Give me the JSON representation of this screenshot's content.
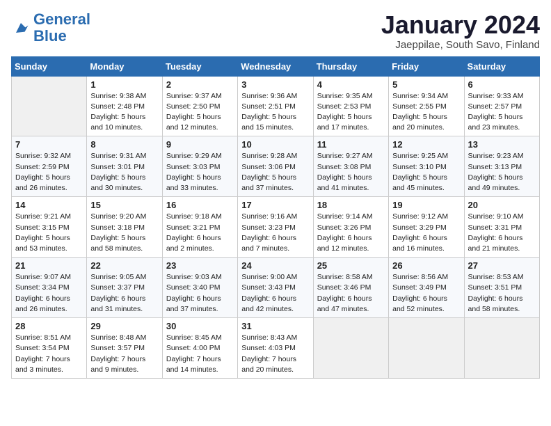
{
  "logo": {
    "line1": "General",
    "line2": "Blue"
  },
  "calendar": {
    "title": "January 2024",
    "subtitle": "Jaeppilae, South Savo, Finland"
  },
  "headers": [
    "Sunday",
    "Monday",
    "Tuesday",
    "Wednesday",
    "Thursday",
    "Friday",
    "Saturday"
  ],
  "weeks": [
    [
      {
        "day": "",
        "sunrise": "",
        "sunset": "",
        "daylight": ""
      },
      {
        "day": "1",
        "sunrise": "Sunrise: 9:38 AM",
        "sunset": "Sunset: 2:48 PM",
        "daylight": "Daylight: 5 hours and 10 minutes."
      },
      {
        "day": "2",
        "sunrise": "Sunrise: 9:37 AM",
        "sunset": "Sunset: 2:50 PM",
        "daylight": "Daylight: 5 hours and 12 minutes."
      },
      {
        "day": "3",
        "sunrise": "Sunrise: 9:36 AM",
        "sunset": "Sunset: 2:51 PM",
        "daylight": "Daylight: 5 hours and 15 minutes."
      },
      {
        "day": "4",
        "sunrise": "Sunrise: 9:35 AM",
        "sunset": "Sunset: 2:53 PM",
        "daylight": "Daylight: 5 hours and 17 minutes."
      },
      {
        "day": "5",
        "sunrise": "Sunrise: 9:34 AM",
        "sunset": "Sunset: 2:55 PM",
        "daylight": "Daylight: 5 hours and 20 minutes."
      },
      {
        "day": "6",
        "sunrise": "Sunrise: 9:33 AM",
        "sunset": "Sunset: 2:57 PM",
        "daylight": "Daylight: 5 hours and 23 minutes."
      }
    ],
    [
      {
        "day": "7",
        "sunrise": "Sunrise: 9:32 AM",
        "sunset": "Sunset: 2:59 PM",
        "daylight": "Daylight: 5 hours and 26 minutes."
      },
      {
        "day": "8",
        "sunrise": "Sunrise: 9:31 AM",
        "sunset": "Sunset: 3:01 PM",
        "daylight": "Daylight: 5 hours and 30 minutes."
      },
      {
        "day": "9",
        "sunrise": "Sunrise: 9:29 AM",
        "sunset": "Sunset: 3:03 PM",
        "daylight": "Daylight: 5 hours and 33 minutes."
      },
      {
        "day": "10",
        "sunrise": "Sunrise: 9:28 AM",
        "sunset": "Sunset: 3:06 PM",
        "daylight": "Daylight: 5 hours and 37 minutes."
      },
      {
        "day": "11",
        "sunrise": "Sunrise: 9:27 AM",
        "sunset": "Sunset: 3:08 PM",
        "daylight": "Daylight: 5 hours and 41 minutes."
      },
      {
        "day": "12",
        "sunrise": "Sunrise: 9:25 AM",
        "sunset": "Sunset: 3:10 PM",
        "daylight": "Daylight: 5 hours and 45 minutes."
      },
      {
        "day": "13",
        "sunrise": "Sunrise: 9:23 AM",
        "sunset": "Sunset: 3:13 PM",
        "daylight": "Daylight: 5 hours and 49 minutes."
      }
    ],
    [
      {
        "day": "14",
        "sunrise": "Sunrise: 9:21 AM",
        "sunset": "Sunset: 3:15 PM",
        "daylight": "Daylight: 5 hours and 53 minutes."
      },
      {
        "day": "15",
        "sunrise": "Sunrise: 9:20 AM",
        "sunset": "Sunset: 3:18 PM",
        "daylight": "Daylight: 5 hours and 58 minutes."
      },
      {
        "day": "16",
        "sunrise": "Sunrise: 9:18 AM",
        "sunset": "Sunset: 3:21 PM",
        "daylight": "Daylight: 6 hours and 2 minutes."
      },
      {
        "day": "17",
        "sunrise": "Sunrise: 9:16 AM",
        "sunset": "Sunset: 3:23 PM",
        "daylight": "Daylight: 6 hours and 7 minutes."
      },
      {
        "day": "18",
        "sunrise": "Sunrise: 9:14 AM",
        "sunset": "Sunset: 3:26 PM",
        "daylight": "Daylight: 6 hours and 12 minutes."
      },
      {
        "day": "19",
        "sunrise": "Sunrise: 9:12 AM",
        "sunset": "Sunset: 3:29 PM",
        "daylight": "Daylight: 6 hours and 16 minutes."
      },
      {
        "day": "20",
        "sunrise": "Sunrise: 9:10 AM",
        "sunset": "Sunset: 3:31 PM",
        "daylight": "Daylight: 6 hours and 21 minutes."
      }
    ],
    [
      {
        "day": "21",
        "sunrise": "Sunrise: 9:07 AM",
        "sunset": "Sunset: 3:34 PM",
        "daylight": "Daylight: 6 hours and 26 minutes."
      },
      {
        "day": "22",
        "sunrise": "Sunrise: 9:05 AM",
        "sunset": "Sunset: 3:37 PM",
        "daylight": "Daylight: 6 hours and 31 minutes."
      },
      {
        "day": "23",
        "sunrise": "Sunrise: 9:03 AM",
        "sunset": "Sunset: 3:40 PM",
        "daylight": "Daylight: 6 hours and 37 minutes."
      },
      {
        "day": "24",
        "sunrise": "Sunrise: 9:00 AM",
        "sunset": "Sunset: 3:43 PM",
        "daylight": "Daylight: 6 hours and 42 minutes."
      },
      {
        "day": "25",
        "sunrise": "Sunrise: 8:58 AM",
        "sunset": "Sunset: 3:46 PM",
        "daylight": "Daylight: 6 hours and 47 minutes."
      },
      {
        "day": "26",
        "sunrise": "Sunrise: 8:56 AM",
        "sunset": "Sunset: 3:49 PM",
        "daylight": "Daylight: 6 hours and 52 minutes."
      },
      {
        "day": "27",
        "sunrise": "Sunrise: 8:53 AM",
        "sunset": "Sunset: 3:51 PM",
        "daylight": "Daylight: 6 hours and 58 minutes."
      }
    ],
    [
      {
        "day": "28",
        "sunrise": "Sunrise: 8:51 AM",
        "sunset": "Sunset: 3:54 PM",
        "daylight": "Daylight: 7 hours and 3 minutes."
      },
      {
        "day": "29",
        "sunrise": "Sunrise: 8:48 AM",
        "sunset": "Sunset: 3:57 PM",
        "daylight": "Daylight: 7 hours and 9 minutes."
      },
      {
        "day": "30",
        "sunrise": "Sunrise: 8:45 AM",
        "sunset": "Sunset: 4:00 PM",
        "daylight": "Daylight: 7 hours and 14 minutes."
      },
      {
        "day": "31",
        "sunrise": "Sunrise: 8:43 AM",
        "sunset": "Sunset: 4:03 PM",
        "daylight": "Daylight: 7 hours and 20 minutes."
      },
      {
        "day": "",
        "sunrise": "",
        "sunset": "",
        "daylight": ""
      },
      {
        "day": "",
        "sunrise": "",
        "sunset": "",
        "daylight": ""
      },
      {
        "day": "",
        "sunrise": "",
        "sunset": "",
        "daylight": ""
      }
    ]
  ]
}
